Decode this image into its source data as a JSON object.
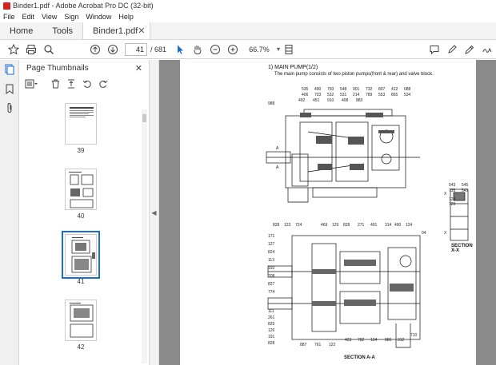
{
  "window": {
    "title": "Binder1.pdf - Adobe Acrobat Pro DC (32-bit)"
  },
  "menu": [
    "File",
    "Edit",
    "View",
    "Sign",
    "Window",
    "Help"
  ],
  "tabs": {
    "home": "Home",
    "tools": "Tools",
    "document": "Binder1.pdf"
  },
  "toolbar": {
    "current_page": "41",
    "page_total": "/ 681",
    "zoom": "66.7%"
  },
  "thumbnails": {
    "header": "Page Thumbnails",
    "pages": [
      "39",
      "40",
      "41",
      "42"
    ],
    "selected": "41"
  },
  "document": {
    "heading": "1)  MAIN PUMP(1/2)",
    "subheading": "The main pump consists of two piston pumps(front & rear) and valve block.",
    "section_xx": "SECTION  X-X",
    "section_aa": "SECTION  A-A",
    "top_callouts": [
      "535",
      "490",
      "793",
      "548",
      "901",
      "732",
      "807",
      "412",
      "088",
      "406",
      "703",
      "532",
      "531",
      "214",
      "789",
      "553",
      "865",
      "534",
      "492",
      "451",
      "910",
      "988",
      "408",
      "883"
    ],
    "bottom_callouts": [
      "828",
      "123",
      "724",
      "469",
      "129",
      "828",
      "271",
      "491",
      "314",
      "490",
      "124",
      "04",
      "171",
      "127",
      "824",
      "113",
      "192",
      "708",
      "827",
      "774",
      "111",
      "261",
      "825",
      "126",
      "191",
      "828",
      "887",
      "761",
      "122",
      "423",
      "782",
      "124",
      "886",
      "312",
      "710"
    ],
    "side_callouts": [
      "543",
      "545",
      "735",
      "541",
      "724",
      "729"
    ]
  },
  "colors": {
    "accent": "#1a6fc9",
    "doc_bg": "#8a8a8a"
  }
}
